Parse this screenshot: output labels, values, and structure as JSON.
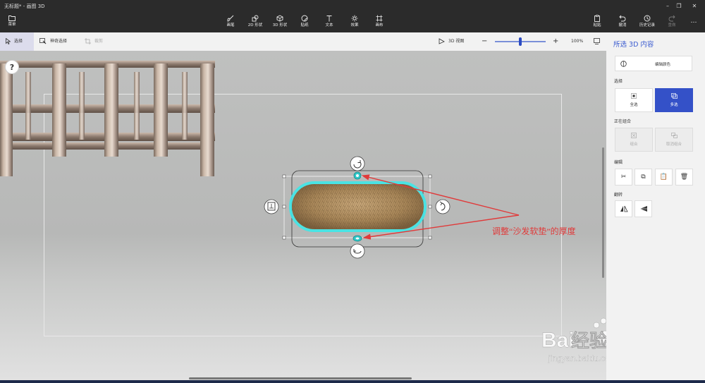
{
  "app": {
    "title": "无标题* - 画图 3D",
    "minimize": "–",
    "maximize": "❐",
    "close": "✕"
  },
  "toolbar": {
    "menu": "菜单",
    "brushes": "画笔",
    "shapes2d": "2D 形状",
    "shapes3d": "3D 形状",
    "stickers": "贴纸",
    "text": "文本",
    "effects": "效果",
    "canvas": "画布",
    "paste": "粘贴",
    "undo": "撤消",
    "history": "历史记录",
    "redo": "重做",
    "more": "…"
  },
  "subbar": {
    "select": "选择",
    "magic_select": "神奇选择",
    "crop": "裁剪",
    "view3d": "3D 视图",
    "zoom_minus": "−",
    "zoom_plus": "+",
    "zoom_level": "100%",
    "zoom_fraction": 0.5
  },
  "canvas": {
    "help": "?",
    "annotation": "调整“沙发软垫”的厚度",
    "watermark_brand": "Bai",
    "watermark_brand2": "经验",
    "watermark_url": "jingyan.baidu.com"
  },
  "panel": {
    "title": "所选 3D 内容",
    "edit_color": "编辑颜色",
    "section_select": "选择",
    "select_all": "全选",
    "multi_select": "多选",
    "section_group": "正在组合",
    "group": "组合",
    "ungroup": "取消组合",
    "section_edit": "编辑",
    "cut_icon": "✂",
    "copy_icon": "⧉",
    "paste_icon": "📋",
    "delete_icon": "🗑",
    "section_flip": "翻转"
  },
  "colors": {
    "accent": "#3451c8",
    "selection_glow": "#3ee8e8",
    "annotation": "#e03a3a"
  }
}
